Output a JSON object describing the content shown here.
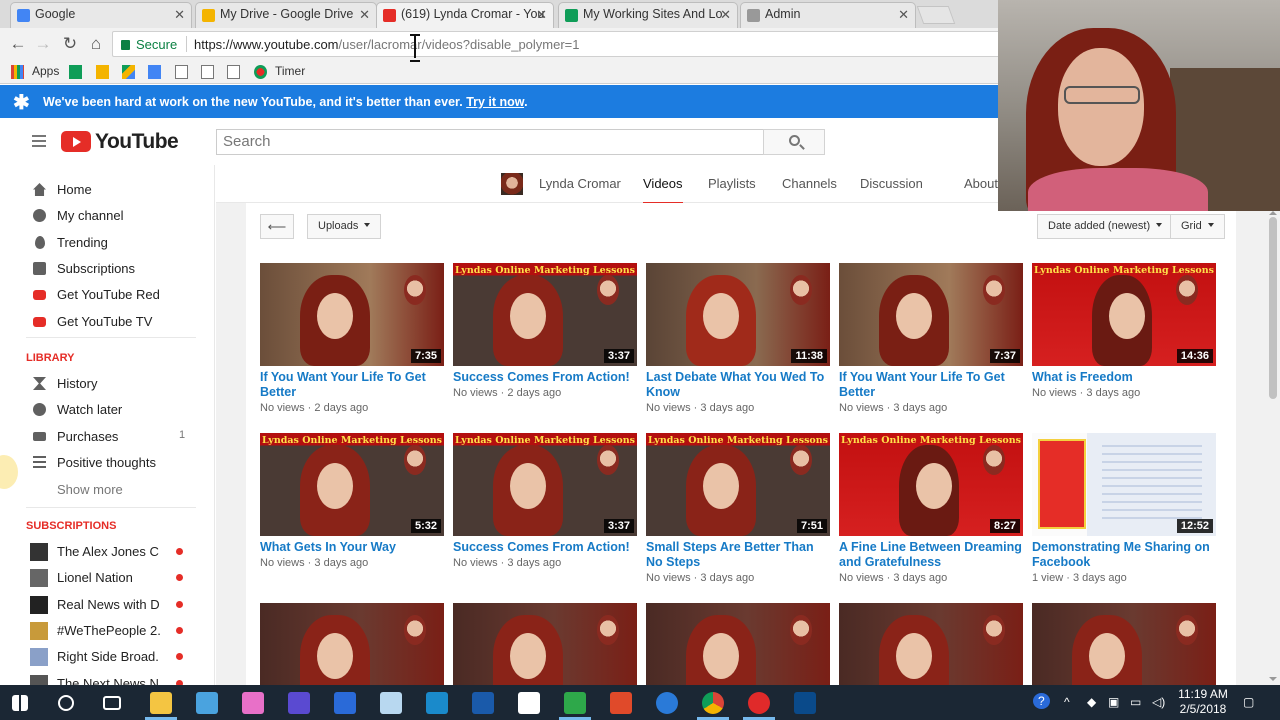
{
  "browser": {
    "tabs": [
      {
        "title": "Google",
        "color": "#4285f4"
      },
      {
        "title": "My Drive - Google Drive",
        "color": "#f4b400"
      },
      {
        "title": "(619) Lynda Cromar - You",
        "color": "#e52d27"
      },
      {
        "title": "My Working Sites And Lo",
        "color": "#0f9d58"
      },
      {
        "title": "Admin",
        "color": "#999999"
      }
    ],
    "secure_label": "Secure",
    "url_base": "https://www.youtube.com",
    "url_path": "/user/lacromar/videos?disable_polymer=1",
    "bookmarks": [
      "Apps",
      "Timer"
    ]
  },
  "banner": {
    "message": "We've been hard at work on the new YouTube, and it's better than ever.",
    "link": "Try it now",
    "period": "."
  },
  "header": {
    "logo_text": "YouTube",
    "search_placeholder": "Search"
  },
  "sidebar": {
    "main": [
      {
        "label": "Home",
        "icon": "home-icon"
      },
      {
        "label": "My channel",
        "icon": "account-icon"
      },
      {
        "label": "Trending",
        "icon": "flame-icon"
      },
      {
        "label": "Subscriptions",
        "icon": "subscriptions-icon"
      },
      {
        "label": "Get YouTube Red",
        "icon": "youtube-red-icon"
      },
      {
        "label": "Get YouTube TV",
        "icon": "youtube-tv-icon"
      }
    ],
    "library_heading": "LIBRARY",
    "library": [
      {
        "label": "History",
        "icon": "hourglass-icon",
        "count": ""
      },
      {
        "label": "Watch later",
        "icon": "clock-icon",
        "count": ""
      },
      {
        "label": "Purchases",
        "icon": "purchases-icon",
        "count": "1"
      },
      {
        "label": "Positive thoughts",
        "icon": "playlist-icon",
        "count": ""
      }
    ],
    "show_more": "Show more",
    "subscriptions_heading": "SUBSCRIPTIONS",
    "subscriptions": [
      {
        "label": "The Alex Jones C..."
      },
      {
        "label": "Lionel Nation"
      },
      {
        "label": "Real News with D..."
      },
      {
        "label": "#WeThePeople 2..."
      },
      {
        "label": "Right Side Broad..."
      },
      {
        "label": "The Next News N..."
      }
    ]
  },
  "channel": {
    "name": "Lynda Cromar",
    "tabs": [
      "Videos",
      "Playlists",
      "Channels",
      "Discussion",
      "About"
    ],
    "active_tab": "Videos"
  },
  "toolbar": {
    "back_arrow": "⟵",
    "uploads": "Uploads",
    "sort": "Date added (newest)",
    "view": "Grid"
  },
  "videos": [
    {
      "title": "If You Want Your Life To Get Better",
      "views": "No views",
      "age": "2 days ago",
      "duration": "7:35",
      "style": "a",
      "banner": ""
    },
    {
      "title": "Success Comes From Action!",
      "views": "No views",
      "age": "2 days ago",
      "duration": "3:37",
      "style": "b",
      "banner": "Lyndas Online Marketing Lessons"
    },
    {
      "title": "Last Debate What You Wed To Know",
      "views": "No views",
      "age": "3 days ago",
      "duration": "11:38",
      "style": "c",
      "banner": ""
    },
    {
      "title": "If You Want Your Life To Get Better",
      "views": "No views",
      "age": "3 days ago",
      "duration": "7:37",
      "style": "a",
      "banner": ""
    },
    {
      "title": "What is Freedom",
      "views": "No views",
      "age": "3 days ago",
      "duration": "14:36",
      "style": "d",
      "banner": "Lyndas Online Marketing Lessons"
    },
    {
      "title": "What Gets In Your Way",
      "views": "No views",
      "age": "3 days ago",
      "duration": "5:32",
      "style": "b",
      "banner": "Lyndas Online Marketing Lessons"
    },
    {
      "title": "Success Comes From Action!",
      "views": "No views",
      "age": "3 days ago",
      "duration": "3:37",
      "style": "b",
      "banner": "Lyndas Online Marketing Lessons"
    },
    {
      "title": "Small Steps Are Better Than No Steps",
      "views": "No views",
      "age": "3 days ago",
      "duration": "7:51",
      "style": "b",
      "banner": "Lyndas Online Marketing Lessons"
    },
    {
      "title": "A Fine Line Between Dreaming and Gratefulness",
      "views": "No views",
      "age": "3 days ago",
      "duration": "8:27",
      "style": "d",
      "banner": "Lyndas Online Marketing Lessons"
    },
    {
      "title": "Demonstrating Me Sharing on Facebook",
      "views": "1 view",
      "age": "3 days ago",
      "duration": "12:52",
      "style": "e",
      "banner": ""
    },
    {
      "title": "",
      "views": "",
      "age": "",
      "duration": "",
      "style": "f",
      "banner": ""
    },
    {
      "title": "",
      "views": "",
      "age": "",
      "duration": "",
      "style": "f",
      "banner": ""
    },
    {
      "title": "",
      "views": "",
      "age": "",
      "duration": "",
      "style": "f",
      "banner": ""
    },
    {
      "title": "",
      "views": "",
      "age": "",
      "duration": "",
      "style": "f",
      "banner": ""
    },
    {
      "title": "",
      "views": "",
      "age": "",
      "duration": "",
      "style": "f",
      "banner": ""
    }
  ],
  "taskbar": {
    "time": "11:19 AM",
    "date": "2/5/2018"
  }
}
